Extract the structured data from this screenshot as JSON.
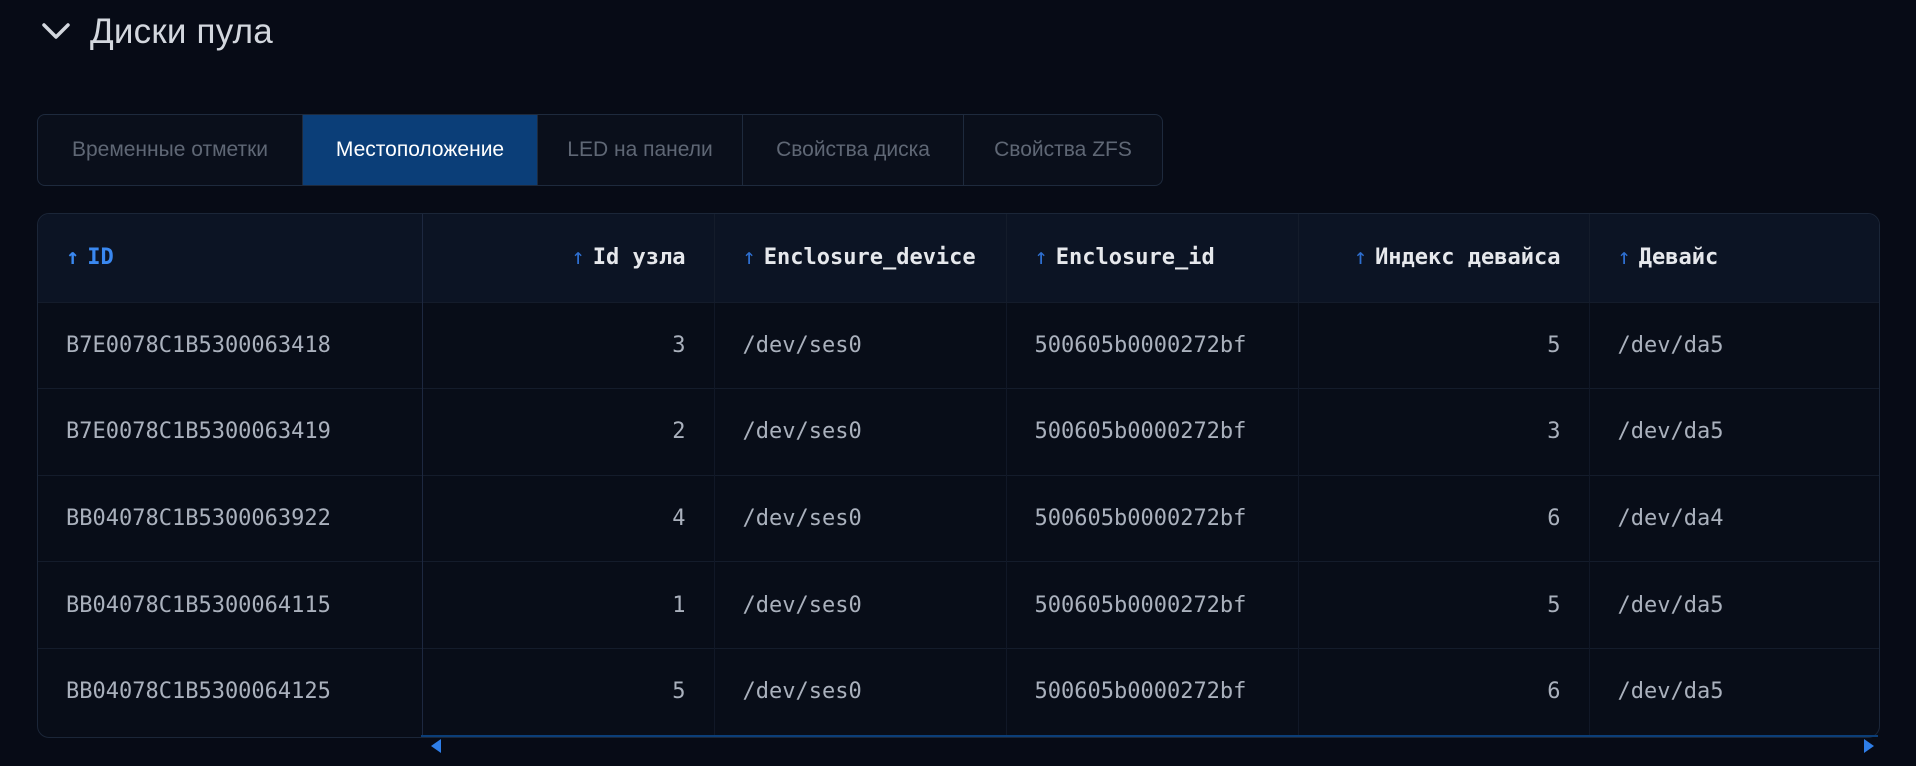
{
  "section": {
    "title": "Диски пула",
    "toggle_icon": "chevron-down-icon"
  },
  "tabs": [
    {
      "label": "Временные отметки",
      "active": false
    },
    {
      "label": "Местоположение",
      "active": true
    },
    {
      "label": "LED на панели",
      "active": false
    },
    {
      "label": "Свойства диска",
      "active": false
    },
    {
      "label": "Свойства ZFS",
      "active": false
    }
  ],
  "table": {
    "sort_icon": "sort-ascending-icon",
    "columns": [
      "ID",
      "Id узла",
      "Enclosure_device",
      "Enclosure_id",
      "Индекс девайса",
      "Девайс"
    ],
    "rows": [
      [
        "B7E0078C1B5300063418",
        "3",
        "/dev/ses0",
        "500605b0000272bf",
        "5",
        "/dev/da5"
      ],
      [
        "B7E0078C1B5300063419",
        "2",
        "/dev/ses0",
        "500605b0000272bf",
        "3",
        "/dev/da5"
      ],
      [
        "BB04078C1B5300063922",
        "4",
        "/dev/ses0",
        "500605b0000272bf",
        "6",
        "/dev/da4"
      ],
      [
        "BB04078C1B5300064115",
        "1",
        "/dev/ses0",
        "500605b0000272bf",
        "5",
        "/dev/da5"
      ],
      [
        "BB04078C1B5300064125",
        "5",
        "/dev/ses0",
        "500605b0000272bf",
        "6",
        "/dev/da5"
      ]
    ]
  },
  "colors": {
    "background": "#070b16",
    "accent": "#0b3e78",
    "link": "#3a88f0"
  }
}
